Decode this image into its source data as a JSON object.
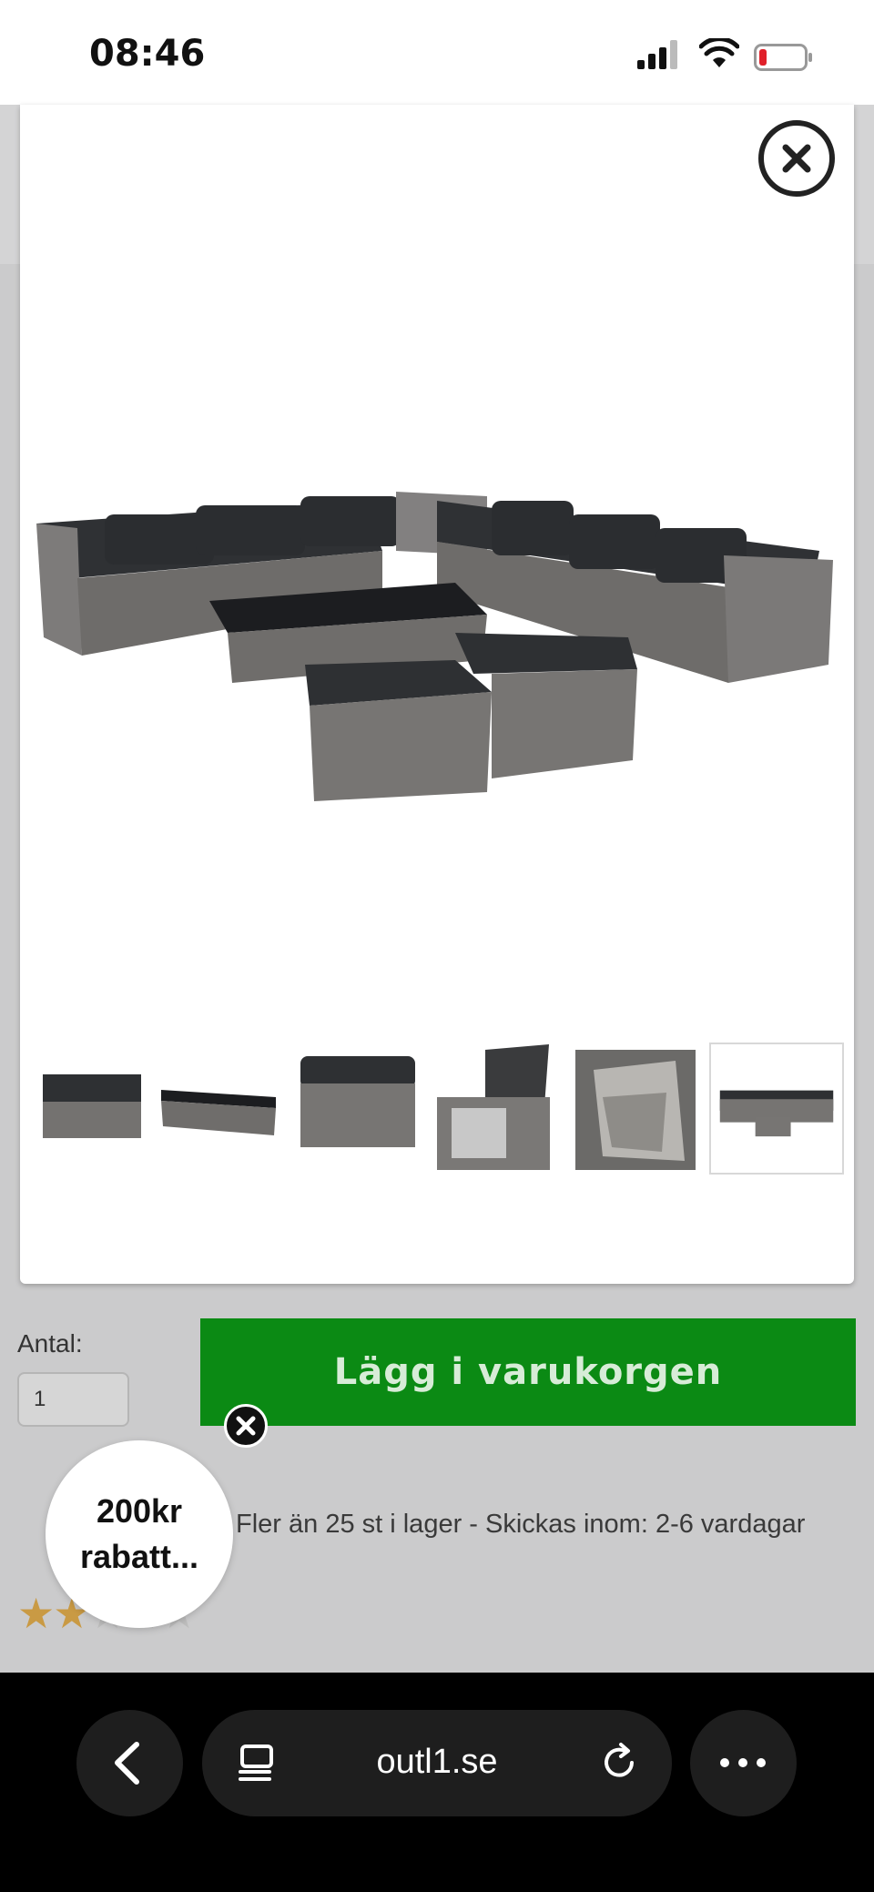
{
  "status_bar": {
    "time": "08:46"
  },
  "gallery": {
    "thumbnails": [
      {
        "label": "sofa-section"
      },
      {
        "label": "coffee-table"
      },
      {
        "label": "ottoman"
      },
      {
        "label": "storage-box-open"
      },
      {
        "label": "storage-box-inside"
      },
      {
        "label": "full-set",
        "selected": true
      }
    ]
  },
  "purchase": {
    "quantity_label": "Antal:",
    "quantity_value": "1",
    "add_to_cart_label": "Lägg i varukorgen",
    "stock_text": "Fler än 25 st i lager - Skickas inom: 2-6 vardagar",
    "rating_stars": 2,
    "rating_max": 5
  },
  "promo": {
    "line1": "200kr",
    "line2": "rabatt..."
  },
  "browser": {
    "url": "outl1.se"
  },
  "colors": {
    "cart_button": "#0b8a14",
    "star": "#c99a44"
  }
}
